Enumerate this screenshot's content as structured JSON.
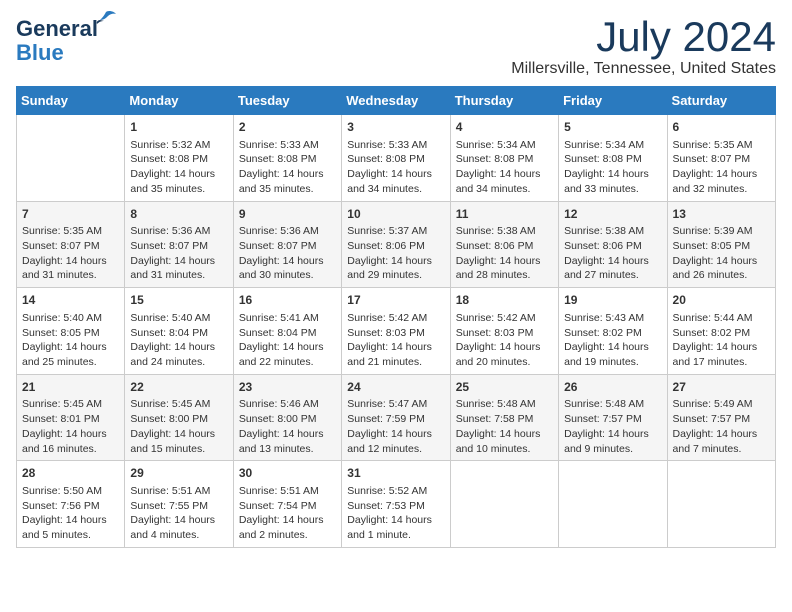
{
  "header": {
    "logo_general": "General",
    "logo_blue": "Blue",
    "month_title": "July 2024",
    "location": "Millersville, Tennessee, United States"
  },
  "columns": [
    "Sunday",
    "Monday",
    "Tuesday",
    "Wednesday",
    "Thursday",
    "Friday",
    "Saturday"
  ],
  "weeks": [
    [
      {
        "day": "",
        "sunrise": "",
        "sunset": "",
        "daylight": ""
      },
      {
        "day": "1",
        "sunrise": "Sunrise: 5:32 AM",
        "sunset": "Sunset: 8:08 PM",
        "daylight": "Daylight: 14 hours and 35 minutes."
      },
      {
        "day": "2",
        "sunrise": "Sunrise: 5:33 AM",
        "sunset": "Sunset: 8:08 PM",
        "daylight": "Daylight: 14 hours and 35 minutes."
      },
      {
        "day": "3",
        "sunrise": "Sunrise: 5:33 AM",
        "sunset": "Sunset: 8:08 PM",
        "daylight": "Daylight: 14 hours and 34 minutes."
      },
      {
        "day": "4",
        "sunrise": "Sunrise: 5:34 AM",
        "sunset": "Sunset: 8:08 PM",
        "daylight": "Daylight: 14 hours and 34 minutes."
      },
      {
        "day": "5",
        "sunrise": "Sunrise: 5:34 AM",
        "sunset": "Sunset: 8:08 PM",
        "daylight": "Daylight: 14 hours and 33 minutes."
      },
      {
        "day": "6",
        "sunrise": "Sunrise: 5:35 AM",
        "sunset": "Sunset: 8:07 PM",
        "daylight": "Daylight: 14 hours and 32 minutes."
      }
    ],
    [
      {
        "day": "7",
        "sunrise": "Sunrise: 5:35 AM",
        "sunset": "Sunset: 8:07 PM",
        "daylight": "Daylight: 14 hours and 31 minutes."
      },
      {
        "day": "8",
        "sunrise": "Sunrise: 5:36 AM",
        "sunset": "Sunset: 8:07 PM",
        "daylight": "Daylight: 14 hours and 31 minutes."
      },
      {
        "day": "9",
        "sunrise": "Sunrise: 5:36 AM",
        "sunset": "Sunset: 8:07 PM",
        "daylight": "Daylight: 14 hours and 30 minutes."
      },
      {
        "day": "10",
        "sunrise": "Sunrise: 5:37 AM",
        "sunset": "Sunset: 8:06 PM",
        "daylight": "Daylight: 14 hours and 29 minutes."
      },
      {
        "day": "11",
        "sunrise": "Sunrise: 5:38 AM",
        "sunset": "Sunset: 8:06 PM",
        "daylight": "Daylight: 14 hours and 28 minutes."
      },
      {
        "day": "12",
        "sunrise": "Sunrise: 5:38 AM",
        "sunset": "Sunset: 8:06 PM",
        "daylight": "Daylight: 14 hours and 27 minutes."
      },
      {
        "day": "13",
        "sunrise": "Sunrise: 5:39 AM",
        "sunset": "Sunset: 8:05 PM",
        "daylight": "Daylight: 14 hours and 26 minutes."
      }
    ],
    [
      {
        "day": "14",
        "sunrise": "Sunrise: 5:40 AM",
        "sunset": "Sunset: 8:05 PM",
        "daylight": "Daylight: 14 hours and 25 minutes."
      },
      {
        "day": "15",
        "sunrise": "Sunrise: 5:40 AM",
        "sunset": "Sunset: 8:04 PM",
        "daylight": "Daylight: 14 hours and 24 minutes."
      },
      {
        "day": "16",
        "sunrise": "Sunrise: 5:41 AM",
        "sunset": "Sunset: 8:04 PM",
        "daylight": "Daylight: 14 hours and 22 minutes."
      },
      {
        "day": "17",
        "sunrise": "Sunrise: 5:42 AM",
        "sunset": "Sunset: 8:03 PM",
        "daylight": "Daylight: 14 hours and 21 minutes."
      },
      {
        "day": "18",
        "sunrise": "Sunrise: 5:42 AM",
        "sunset": "Sunset: 8:03 PM",
        "daylight": "Daylight: 14 hours and 20 minutes."
      },
      {
        "day": "19",
        "sunrise": "Sunrise: 5:43 AM",
        "sunset": "Sunset: 8:02 PM",
        "daylight": "Daylight: 14 hours and 19 minutes."
      },
      {
        "day": "20",
        "sunrise": "Sunrise: 5:44 AM",
        "sunset": "Sunset: 8:02 PM",
        "daylight": "Daylight: 14 hours and 17 minutes."
      }
    ],
    [
      {
        "day": "21",
        "sunrise": "Sunrise: 5:45 AM",
        "sunset": "Sunset: 8:01 PM",
        "daylight": "Daylight: 14 hours and 16 minutes."
      },
      {
        "day": "22",
        "sunrise": "Sunrise: 5:45 AM",
        "sunset": "Sunset: 8:00 PM",
        "daylight": "Daylight: 14 hours and 15 minutes."
      },
      {
        "day": "23",
        "sunrise": "Sunrise: 5:46 AM",
        "sunset": "Sunset: 8:00 PM",
        "daylight": "Daylight: 14 hours and 13 minutes."
      },
      {
        "day": "24",
        "sunrise": "Sunrise: 5:47 AM",
        "sunset": "Sunset: 7:59 PM",
        "daylight": "Daylight: 14 hours and 12 minutes."
      },
      {
        "day": "25",
        "sunrise": "Sunrise: 5:48 AM",
        "sunset": "Sunset: 7:58 PM",
        "daylight": "Daylight: 14 hours and 10 minutes."
      },
      {
        "day": "26",
        "sunrise": "Sunrise: 5:48 AM",
        "sunset": "Sunset: 7:57 PM",
        "daylight": "Daylight: 14 hours and 9 minutes."
      },
      {
        "day": "27",
        "sunrise": "Sunrise: 5:49 AM",
        "sunset": "Sunset: 7:57 PM",
        "daylight": "Daylight: 14 hours and 7 minutes."
      }
    ],
    [
      {
        "day": "28",
        "sunrise": "Sunrise: 5:50 AM",
        "sunset": "Sunset: 7:56 PM",
        "daylight": "Daylight: 14 hours and 5 minutes."
      },
      {
        "day": "29",
        "sunrise": "Sunrise: 5:51 AM",
        "sunset": "Sunset: 7:55 PM",
        "daylight": "Daylight: 14 hours and 4 minutes."
      },
      {
        "day": "30",
        "sunrise": "Sunrise: 5:51 AM",
        "sunset": "Sunset: 7:54 PM",
        "daylight": "Daylight: 14 hours and 2 minutes."
      },
      {
        "day": "31",
        "sunrise": "Sunrise: 5:52 AM",
        "sunset": "Sunset: 7:53 PM",
        "daylight": "Daylight: 14 hours and 1 minute."
      },
      {
        "day": "",
        "sunrise": "",
        "sunset": "",
        "daylight": ""
      },
      {
        "day": "",
        "sunrise": "",
        "sunset": "",
        "daylight": ""
      },
      {
        "day": "",
        "sunrise": "",
        "sunset": "",
        "daylight": ""
      }
    ]
  ]
}
